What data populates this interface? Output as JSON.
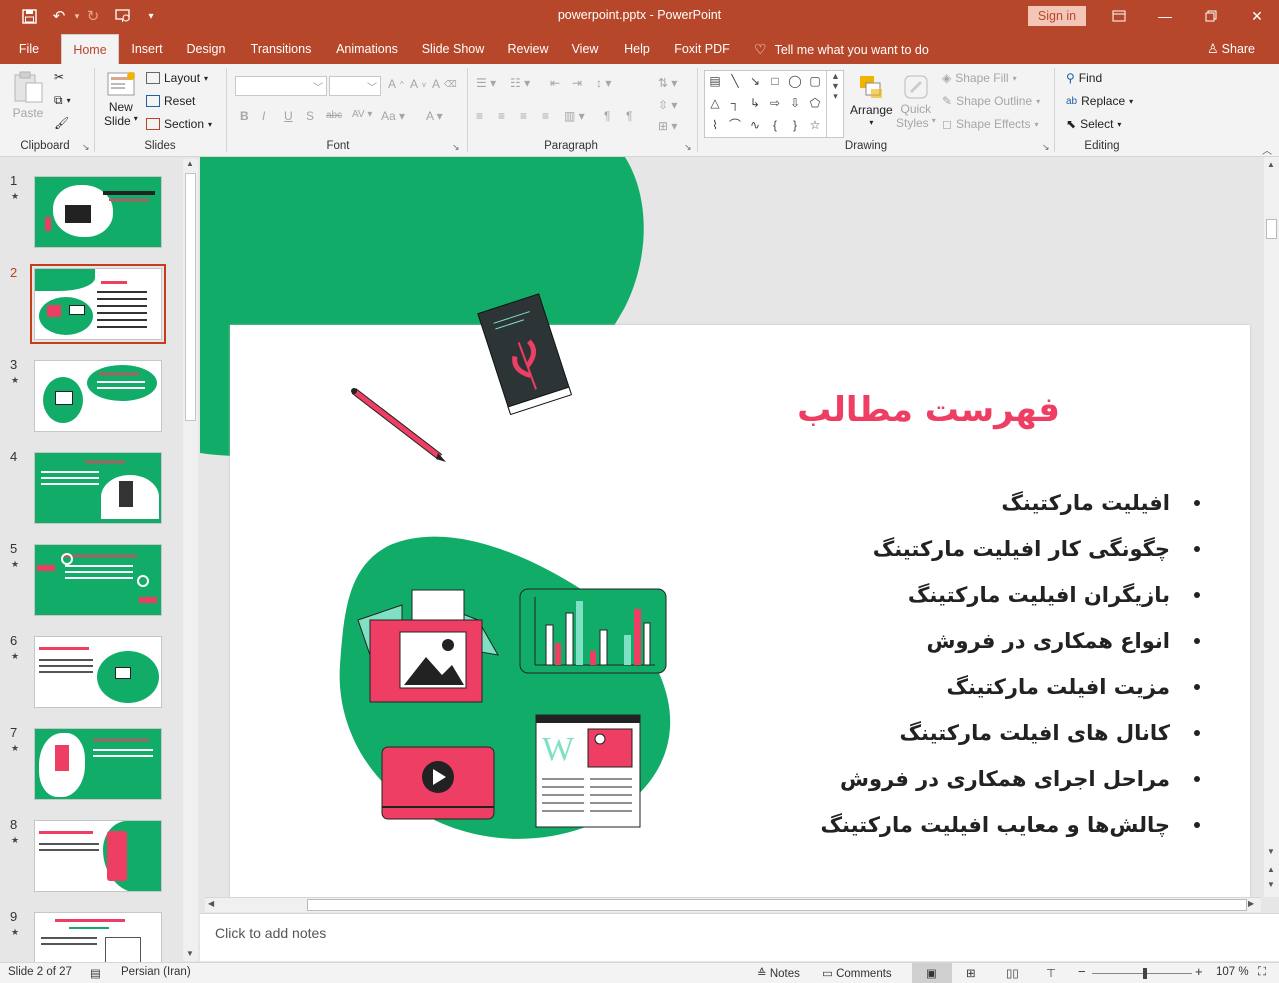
{
  "titlebar": {
    "title": "powerpoint.pptx  -  PowerPoint",
    "signin": "Sign in"
  },
  "tabs": [
    {
      "label": "File"
    },
    {
      "label": "Home"
    },
    {
      "label": "Insert"
    },
    {
      "label": "Design"
    },
    {
      "label": "Transitions"
    },
    {
      "label": "Animations"
    },
    {
      "label": "Slide Show"
    },
    {
      "label": "Review"
    },
    {
      "label": "View"
    },
    {
      "label": "Help"
    },
    {
      "label": "Foxit PDF"
    }
  ],
  "tellme": "Tell me what you want to do",
  "share": "Share",
  "ribbon": {
    "clipboard": {
      "paste": "Paste",
      "label": "Clipboard"
    },
    "slides": {
      "new_slide_1": "New",
      "new_slide_2": "Slide",
      "layout": "Layout",
      "reset": "Reset",
      "section": "Section",
      "label": "Slides"
    },
    "font": {
      "label": "Font"
    },
    "paragraph": {
      "label": "Paragraph"
    },
    "drawing": {
      "arrange": "Arrange",
      "quick_styles_1": "Quick",
      "quick_styles_2": "Styles",
      "shape_fill": "Shape Fill",
      "shape_outline": "Shape Outline",
      "shape_effects": "Shape Effects",
      "label": "Drawing"
    },
    "editing": {
      "find": "Find",
      "replace": "Replace",
      "select": "Select",
      "label": "Editing"
    }
  },
  "thumbnails": [
    {
      "num": "1",
      "star": "★"
    },
    {
      "num": "2",
      "star": "★"
    },
    {
      "num": "3",
      "star": "★"
    },
    {
      "num": "4",
      "star": "★"
    },
    {
      "num": "5",
      "star": "★"
    },
    {
      "num": "6",
      "star": "★"
    },
    {
      "num": "7",
      "star": "★"
    },
    {
      "num": "8",
      "star": "★"
    },
    {
      "num": "9",
      "star": "★"
    }
  ],
  "slide": {
    "title": "فهرست مطالب",
    "bullets": [
      "افیلیت مارکتینگ",
      "چگونگی کار افیلیت مارکتینگ",
      "بازیگران افیلیت مارکتینگ",
      "انواع همکاری در فروش",
      "مزیت افیلت مارکتینگ",
      "کانال های افیلت مارکتینگ",
      "مراحل اجرای همکاری در فروش",
      "چالش‌ها و معایب افیلیت مارکتینگ"
    ]
  },
  "notes_placeholder": "Click to add notes",
  "status": {
    "slide": "Slide 2 of 27",
    "language": "Persian (Iran)",
    "notes": "Notes",
    "comments": "Comments",
    "zoom": "107 %",
    "zoom_level": 0.53
  },
  "colors": {
    "brand": "#b7472a",
    "slide_green": "#11ad68",
    "slide_pink": "#ee3e64"
  }
}
